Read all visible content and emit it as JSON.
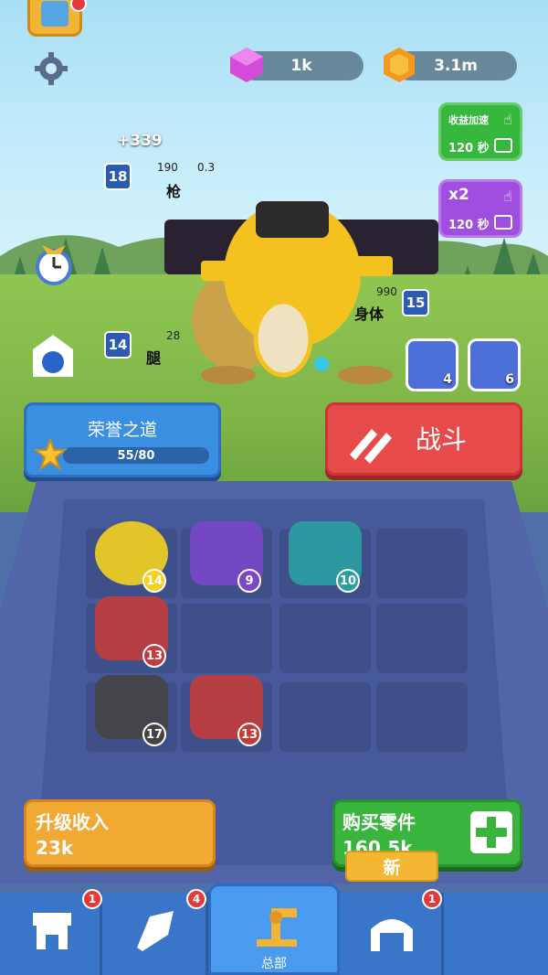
{
  "resources": {
    "gems": "1k",
    "coins": "3.1m"
  },
  "boosts": [
    {
      "title": "收益加速",
      "time": "120 秒"
    },
    {
      "title": "x2",
      "time": "120 秒"
    }
  ],
  "robot": {
    "income_popup": "+339",
    "parts": [
      {
        "name": "枪",
        "level": "18",
        "attack": "190",
        "speed": "0.3"
      },
      {
        "name": "身体",
        "level": "15",
        "defense": "990"
      },
      {
        "name": "腿",
        "level": "14",
        "stat": "28"
      }
    ]
  },
  "skills": [
    {
      "count": "4"
    },
    {
      "count": "6"
    }
  ],
  "honor": {
    "title": "荣誉之道",
    "progress": "55/80",
    "fraction": 0.6875
  },
  "battle": {
    "label": "战斗"
  },
  "board": {
    "parts": [
      {
        "row": 0,
        "col": 0,
        "level": "14",
        "kind": "head",
        "color": "#f4d020"
      },
      {
        "row": 0,
        "col": 1,
        "level": "9",
        "kind": "gun",
        "color": "#7a47c9"
      },
      {
        "row": 0,
        "col": 2,
        "level": "10",
        "kind": "legs",
        "color": "#2a9ea0"
      },
      {
        "row": 1,
        "col": 0,
        "level": "13",
        "kind": "car",
        "color": "#c23c3c"
      },
      {
        "row": 2,
        "col": 0,
        "level": "17",
        "kind": "block",
        "color": "#444"
      },
      {
        "row": 2,
        "col": 1,
        "level": "13",
        "kind": "car",
        "color": "#c23c3c"
      }
    ]
  },
  "upgrade": {
    "title": "升级收入",
    "value": "23k"
  },
  "buy": {
    "title": "购买零件",
    "value": "160.5k",
    "badge": "新"
  },
  "nav": {
    "tabs": [
      {
        "name": "shop",
        "badge": "1"
      },
      {
        "name": "parts",
        "badge": "4"
      },
      {
        "name": "hq",
        "label": "总部"
      },
      {
        "name": "garage",
        "badge": "1"
      }
    ]
  }
}
